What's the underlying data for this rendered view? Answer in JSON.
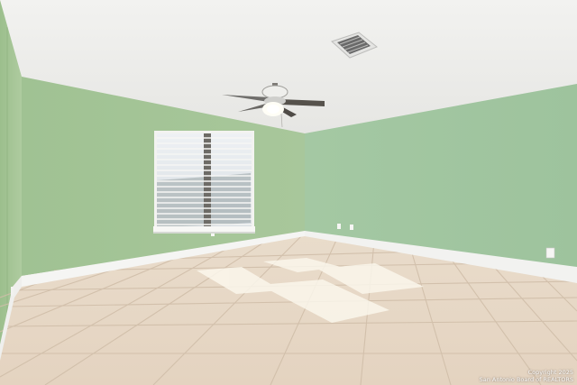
{
  "photo": {
    "subject": "Empty room with green walls, tile floor, ceiling fan and window with blinds",
    "watermark": {
      "line1": "Copyright 2025",
      "line2": "San Antonio Board of REALTORS"
    }
  },
  "colors": {
    "ceiling": "#f4f4f2",
    "wall_left": "#a9c79b",
    "wall_back": "#a3c497",
    "wall_right": "#a4c9a6",
    "floor": "#e7d8c6",
    "grout": "#cdbba6",
    "baseboard": "#f4f4f2",
    "sunlight": "#fbf6ea"
  }
}
